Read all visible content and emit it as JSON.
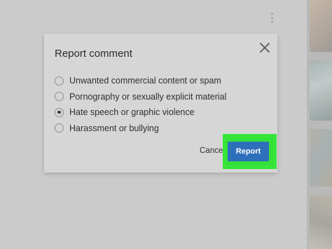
{
  "dialog": {
    "title": "Report comment",
    "close_icon": "close-icon",
    "options": [
      {
        "label": "Unwanted commercial content or spam",
        "selected": false
      },
      {
        "label": "Pornography or sexually explicit material",
        "selected": false
      },
      {
        "label": "Hate speech or graphic violence",
        "selected": true
      },
      {
        "label": "Harassment or bullying",
        "selected": false
      }
    ],
    "cancel_label": "Cancel",
    "report_label": "Report"
  },
  "background": {
    "menu_icon": "more-vertical-icon"
  },
  "colors": {
    "report_button": "#2e6fbb",
    "highlight": "#36e63a",
    "overlay": "#cbcbcb"
  }
}
